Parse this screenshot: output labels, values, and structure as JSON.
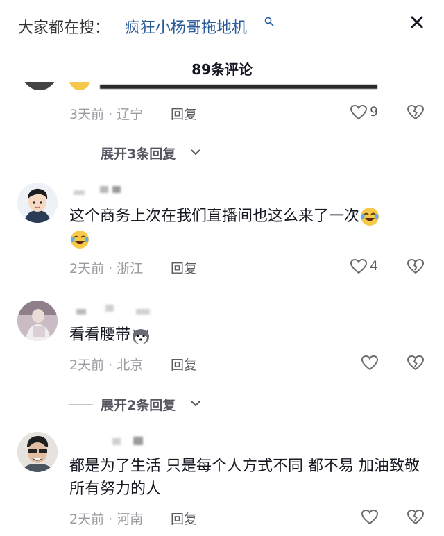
{
  "search": {
    "prefix": "大家都在搜：",
    "term": "疯狂小杨哥拖地机",
    "search_icon": "search-icon",
    "close_icon": "close-icon"
  },
  "header": {
    "comment_count_title": "89条评论"
  },
  "colors": {
    "link": "#2a5a9a",
    "meta": "#9a9ba0",
    "text": "#161823"
  },
  "top_comment": {
    "meta": "3天前 · 辽宁",
    "reply": "回复",
    "likes": "9",
    "expand_label": "展开3条回复"
  },
  "comments": [
    {
      "text": "这个商务上次在我们直播间也这么来了一次",
      "emoji": "laughing-crying-emoji",
      "meta": "2天前 · 浙江",
      "reply": "回复",
      "likes": "4"
    },
    {
      "text": "看看腰带",
      "emoji": "husky-dog-emoji",
      "meta": "2天前 · 北京",
      "reply": "回复",
      "likes": "",
      "expand_label": "展开2条回复"
    },
    {
      "text": "都是为了生活 只是每个人方式不同 都不易 加油致敬所有努力的人",
      "meta": "2天前 · 河南",
      "reply": "回复",
      "likes": ""
    }
  ]
}
